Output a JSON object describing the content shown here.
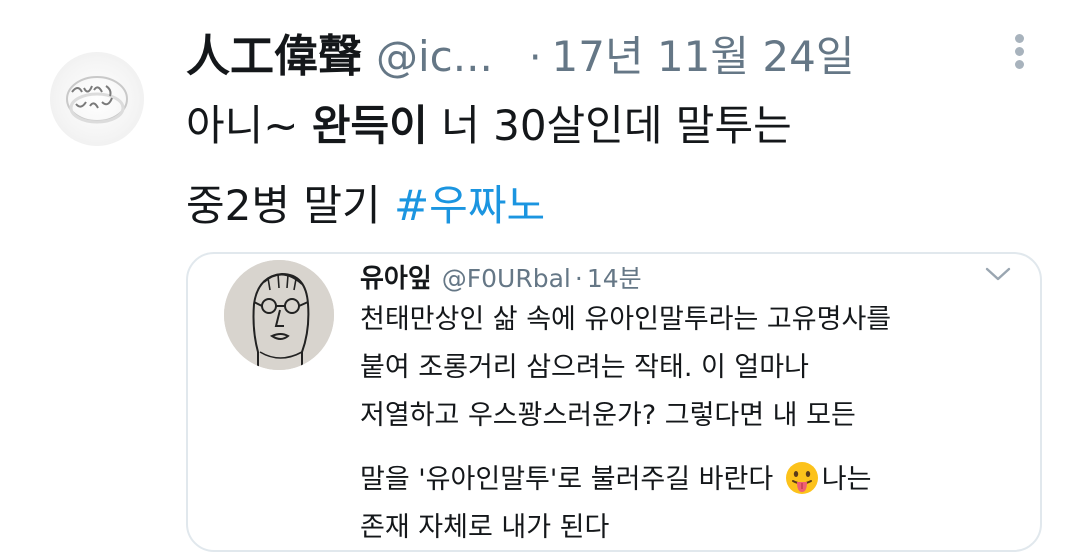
{
  "tweet": {
    "display_name": "人工偉聲",
    "handle": "@ic...",
    "separator": "·",
    "date": "17년 11월 24일",
    "text_part1": "아니~ ",
    "text_bold": "완득이",
    "text_part2": " 너 30살인데 말투는",
    "text_line2": "중2병 말기 ",
    "hashtag": "#우짜노",
    "avatar_icon": "ring-avatar-icon",
    "more_icon": "more-vertical-icon",
    "hashtag_color": "#1b95e0"
  },
  "quote": {
    "display_name": "유아잎",
    "handle": "@F0URbal",
    "separator": "·",
    "time": "14분",
    "lines": [
      "천태만상인 삶 속에 유아인말투라는 고유명사를",
      "붙여 조롱거리 삼으려는 작태. 이 얼마나",
      "저열하고 우스꽝스러운가? 그렇다면 내 모든",
      "말을 '유아인말투'로 불러주길 바란다",
      "나는",
      "존재 자체로 내가 된다"
    ],
    "emoji": "tongue-face-emoji",
    "chevron_icon": "chevron-down-icon",
    "avatar_icon": "sketch-face-avatar-icon"
  }
}
